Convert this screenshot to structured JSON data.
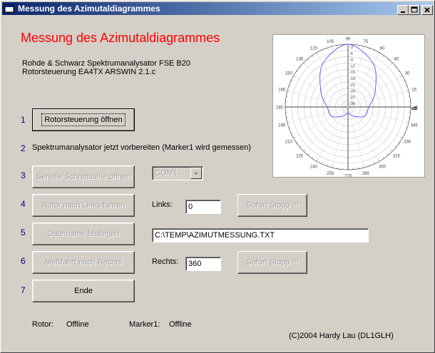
{
  "window": {
    "title": "Messung des Azimutaldiagrammes"
  },
  "heading": "Messung des Azimutaldiagrammes",
  "info": {
    "line1": "Rohde & Schwarz Spektrumanalysator FSE B20",
    "line2": "Rotorsteuerung EA4TX ARSWIN 2.1.c"
  },
  "steps": [
    {
      "num": "1",
      "label": "Rotorsteuerung öffnen"
    },
    {
      "num": "2",
      "label": "Spektrumanalysator jetzt vorbereiten (Marker1 wird gemessen)"
    },
    {
      "num": "3",
      "label": "Serielle Schnittstelle öffnen"
    },
    {
      "num": "4",
      "label": "Rotor nach Links fahren"
    },
    {
      "num": "5",
      "label": "Dateiname festlegen"
    },
    {
      "num": "6",
      "label": "Meßfahrt nach Rechts"
    },
    {
      "num": "7",
      "label": "Ende"
    }
  ],
  "com_port": {
    "value": "COM1"
  },
  "links": {
    "label": "Links:",
    "value": "0",
    "stop_label": "Sofort Stopp !!!"
  },
  "filename": {
    "value": "C:\\TEMP\\AZIMUTMESSUNG.TXT"
  },
  "rechts": {
    "label": "Rechts:",
    "value": "360",
    "stop_label": "Sofort Stopp !!!"
  },
  "status": {
    "rotor_label": "Rotor:",
    "rotor_value": "Offline",
    "marker_label": "Marker1:",
    "marker_value": "Offline"
  },
  "footer": "(C)2004   Hardy Lau (DL1GLH)",
  "colors": {
    "heading": "#ff0000",
    "step_number": "#000080",
    "pattern": "#6060ff",
    "titlebar_start": "#0a246a",
    "titlebar_end": "#a6caf0"
  },
  "icons": {
    "app": "app-window-icon",
    "minimize": "minimize-icon",
    "maximize": "maximize-icon",
    "close": "close-icon",
    "dropdown": "chevron-down-icon"
  },
  "chart_data": {
    "type": "polar",
    "angle_labels": [
      "90",
      "75",
      "60",
      "45",
      "30",
      "15",
      "0",
      "345",
      "330",
      "315",
      "300",
      "285",
      "270",
      "255",
      "240",
      "225",
      "210",
      "195",
      "180",
      "165",
      "150",
      "135",
      "120",
      "105"
    ],
    "radial_labels": [
      "-3",
      "-6",
      "-9",
      "-12",
      "-15",
      "-18",
      "-21",
      "-24",
      "-27",
      "-30"
    ],
    "radial_axis_label": "dB",
    "pattern": {
      "angles": [
        0,
        30,
        60,
        90,
        120,
        150,
        180,
        210,
        240,
        270,
        300,
        330
      ],
      "values": [
        -20,
        -15,
        -6,
        0,
        -6,
        -15,
        -20,
        -21,
        -25,
        -27,
        -25,
        -21
      ]
    }
  }
}
